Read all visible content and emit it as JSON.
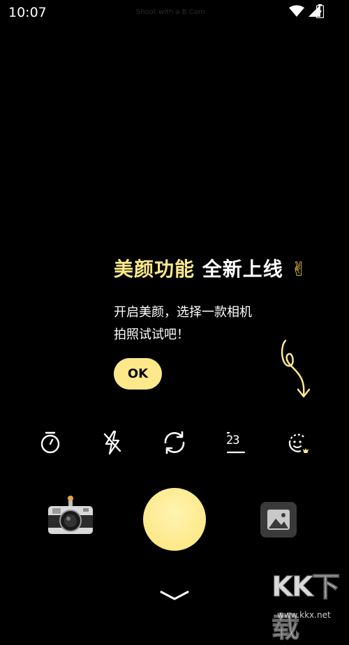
{
  "status_bar": {
    "time": "10:07",
    "center_text": "Shoot with a B Cam"
  },
  "promo": {
    "title_highlight": "美颜功能",
    "title_rest": "全新上线",
    "title_emoji": "✌",
    "body_line1": "开启美颜，选择一款相机",
    "body_line2": "拍照试试吧！",
    "ok_label": "OK"
  },
  "toolbar": {
    "counter_label": "23",
    "icons": [
      "timer-icon",
      "flash-off-icon",
      "switch-camera-icon",
      "counter-icon",
      "beauty-icon"
    ]
  },
  "watermark": {
    "logo": "KK下载",
    "url": "www.kkx.net"
  },
  "colors": {
    "accent": "#fde98a",
    "background": "#000000"
  }
}
